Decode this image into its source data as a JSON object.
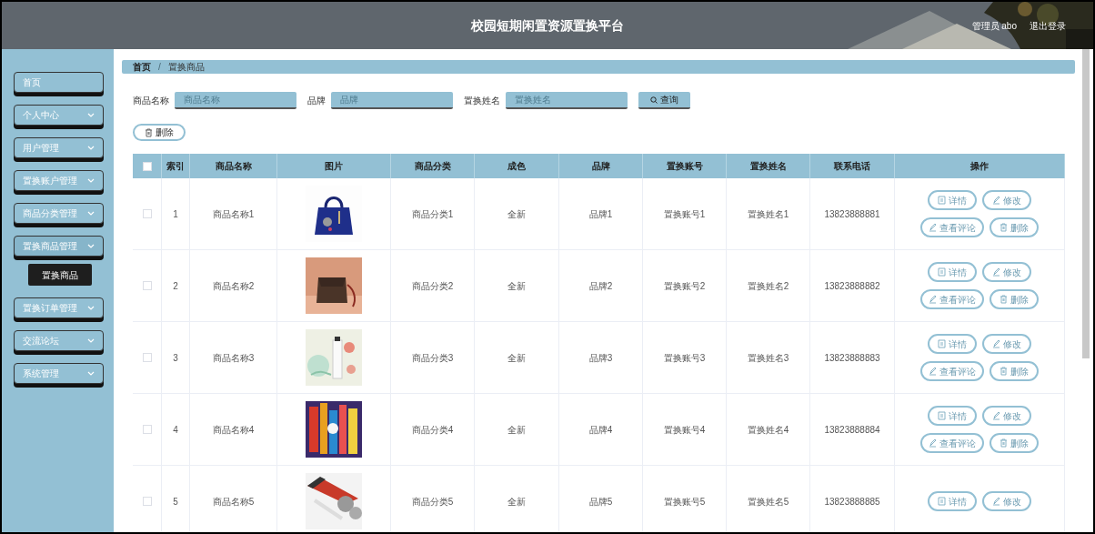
{
  "header": {
    "title": "校园短期闲置资源置换平台",
    "user": "管理员 abo",
    "logout": "退出登录"
  },
  "sidebar": {
    "items": [
      {
        "label": "首页",
        "kind": "link"
      },
      {
        "label": "个人中心",
        "kind": "menu",
        "expanded": false
      },
      {
        "label": "用户管理",
        "kind": "menu",
        "expanded": false
      },
      {
        "label": "置换账户管理",
        "kind": "menu",
        "expanded": false
      },
      {
        "label": "商品分类管理",
        "kind": "menu",
        "expanded": false
      },
      {
        "label": "置换商品管理",
        "kind": "menu",
        "expanded": true,
        "children": [
          {
            "label": "置换商品",
            "selected": true
          }
        ]
      },
      {
        "label": "置换订单管理",
        "kind": "menu",
        "expanded": false
      },
      {
        "label": "交流论坛",
        "kind": "menu",
        "expanded": false
      },
      {
        "label": "系统管理",
        "kind": "menu",
        "expanded": false
      }
    ]
  },
  "breadcrumb": {
    "items": [
      "首页",
      "置换商品"
    ],
    "separator": "/"
  },
  "search": {
    "fields": [
      {
        "label": "商品名称",
        "placeholder": "商品名称"
      },
      {
        "label": "品牌",
        "placeholder": "品牌"
      },
      {
        "label": "置换姓名",
        "placeholder": "置换姓名"
      }
    ],
    "button": "查询"
  },
  "delete_button": "删除",
  "table": {
    "columns": [
      "索引",
      "商品名称",
      "图片",
      "商品分类",
      "成色",
      "品牌",
      "置换账号",
      "置换姓名",
      "联系电话",
      "操作"
    ],
    "all_checked": false,
    "rows": [
      {
        "checked": false,
        "cells": [
          {
            "kind": "text",
            "text": "1"
          },
          {
            "kind": "text",
            "text": "商品名称1"
          },
          {
            "kind": "picture"
          },
          {
            "kind": "text",
            "text": "商品分类1"
          },
          {
            "kind": "text",
            "text": "全新"
          },
          {
            "kind": "text",
            "text": "品牌1"
          },
          {
            "kind": "text",
            "text": "置换账号1"
          },
          {
            "kind": "text",
            "text": "置换姓名1"
          },
          {
            "kind": "text",
            "text": "13823888881"
          }
        ],
        "actions": [
          "详情",
          "修改",
          "查看评论",
          "删除"
        ]
      },
      {
        "checked": false,
        "cells": [
          {
            "kind": "text",
            "text": "2"
          },
          {
            "kind": "text",
            "text": "商品名称2"
          },
          {
            "kind": "picture"
          },
          {
            "kind": "text",
            "text": "商品分类2"
          },
          {
            "kind": "text",
            "text": "全新"
          },
          {
            "kind": "text",
            "text": "品牌2"
          },
          {
            "kind": "text",
            "text": "置换账号2"
          },
          {
            "kind": "text",
            "text": "置换姓名2"
          },
          {
            "kind": "text",
            "text": "13823888882"
          }
        ],
        "actions": [
          "详情",
          "修改",
          "查看评论",
          "删除"
        ]
      },
      {
        "checked": false,
        "cells": [
          {
            "kind": "text",
            "text": "3"
          },
          {
            "kind": "text",
            "text": "商品名称3"
          },
          {
            "kind": "picture"
          },
          {
            "kind": "text",
            "text": "商品分类3"
          },
          {
            "kind": "text",
            "text": "全新"
          },
          {
            "kind": "text",
            "text": "品牌3"
          },
          {
            "kind": "text",
            "text": "置换账号3"
          },
          {
            "kind": "text",
            "text": "置换姓名3"
          },
          {
            "kind": "text",
            "text": "13823888883"
          }
        ],
        "actions": [
          "详情",
          "修改",
          "查看评论",
          "删除"
        ]
      },
      {
        "checked": false,
        "cells": [
          {
            "kind": "text",
            "text": "4"
          },
          {
            "kind": "text",
            "text": "商品名称4"
          },
          {
            "kind": "picture"
          },
          {
            "kind": "text",
            "text": "商品分类4"
          },
          {
            "kind": "text",
            "text": "全新"
          },
          {
            "kind": "text",
            "text": "品牌4"
          },
          {
            "kind": "text",
            "text": "置换账号4"
          },
          {
            "kind": "text",
            "text": "置换姓名4"
          },
          {
            "kind": "text",
            "text": "13823888884"
          }
        ],
        "actions": [
          "详情",
          "修改",
          "查看评论",
          "删除"
        ]
      },
      {
        "checked": false,
        "cells": [
          {
            "kind": "text",
            "text": "5"
          },
          {
            "kind": "text",
            "text": "商品名称5"
          },
          {
            "kind": "picture"
          },
          {
            "kind": "text",
            "text": "商品分类5"
          },
          {
            "kind": "text",
            "text": "全新"
          },
          {
            "kind": "text",
            "text": "品牌5"
          },
          {
            "kind": "text",
            "text": "置换账号5"
          },
          {
            "kind": "text",
            "text": "置换姓名5"
          },
          {
            "kind": "text",
            "text": "13823888885"
          }
        ],
        "actions": [
          "详情",
          "修改"
        ]
      }
    ]
  }
}
